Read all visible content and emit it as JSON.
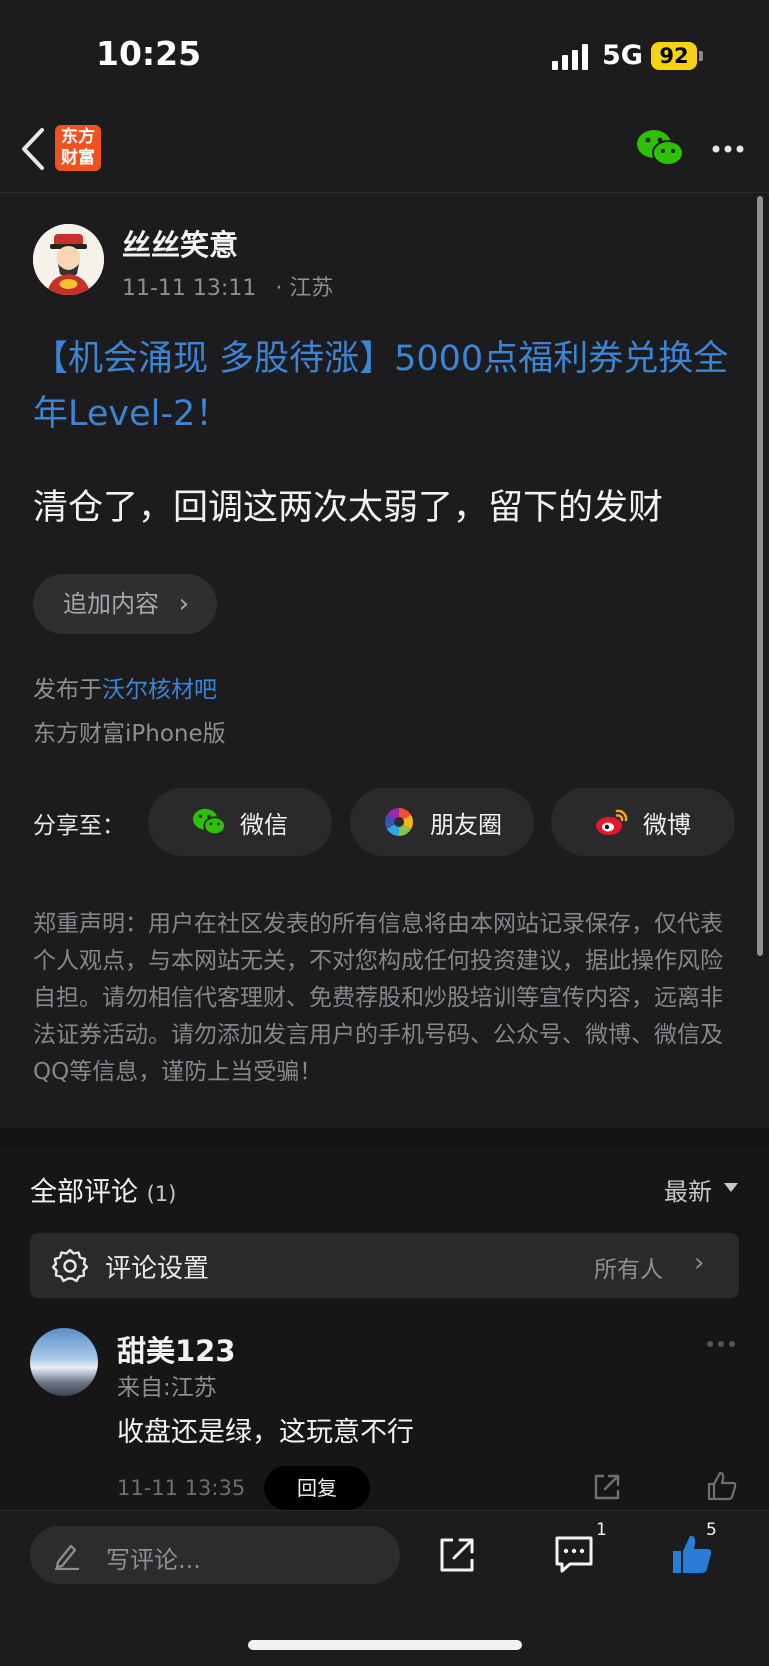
{
  "status_bar": {
    "time": "10:25",
    "network": "5G",
    "battery": "92"
  },
  "nav": {
    "logo_line1": "东方",
    "logo_line2": "财富"
  },
  "post": {
    "author": "丝丝笑意",
    "timestamp": "11-11 13:11",
    "location": "· 江苏",
    "title": "【机会涌现 多股待涨】5000点福利券兑换全年Level-2！",
    "body": "清仓了，回调这两次太弱了，留下的发财",
    "append_label": "追加内容",
    "published_prefix": "发布于",
    "published_forum": "沃尔核材吧",
    "client": "东方财富iPhone版"
  },
  "share": {
    "label": "分享至：",
    "buttons": [
      {
        "label": "微信",
        "icon": "wechat-icon"
      },
      {
        "label": "朋友圈",
        "icon": "moments-icon"
      },
      {
        "label": "微博",
        "icon": "weibo-icon"
      }
    ]
  },
  "disclaimer": "郑重声明：用户在社区发表的所有信息将由本网站记录保存，仅代表个人观点，与本网站无关，不对您构成任何投资建议，据此操作风险自担。请勿相信代客理财、免费荐股和炒股培训等宣传内容，远离非法证券活动。请勿添加发言用户的手机号码、公众号、微博、微信及QQ等信息，谨防上当受骗！",
  "comments": {
    "header": "全部评论",
    "count": "(1)",
    "sort_label": "最新",
    "settings_label": "评论设置",
    "settings_value": "所有人",
    "items": [
      {
        "name": "甜美123",
        "from": "来自:江苏",
        "text": "收盘还是绿，这玩意不行",
        "time": "11-11 13:35",
        "reply_label": "回复"
      }
    ]
  },
  "bottom_bar": {
    "input_placeholder": "写评论...",
    "comment_count": "1",
    "like_count": "5"
  },
  "colors": {
    "link": "#3c84d4",
    "background": "#1c1c1e",
    "like_blue": "#2b7bd9",
    "wechat_green": "#2dc100",
    "logo_orange": "#f0521f"
  }
}
